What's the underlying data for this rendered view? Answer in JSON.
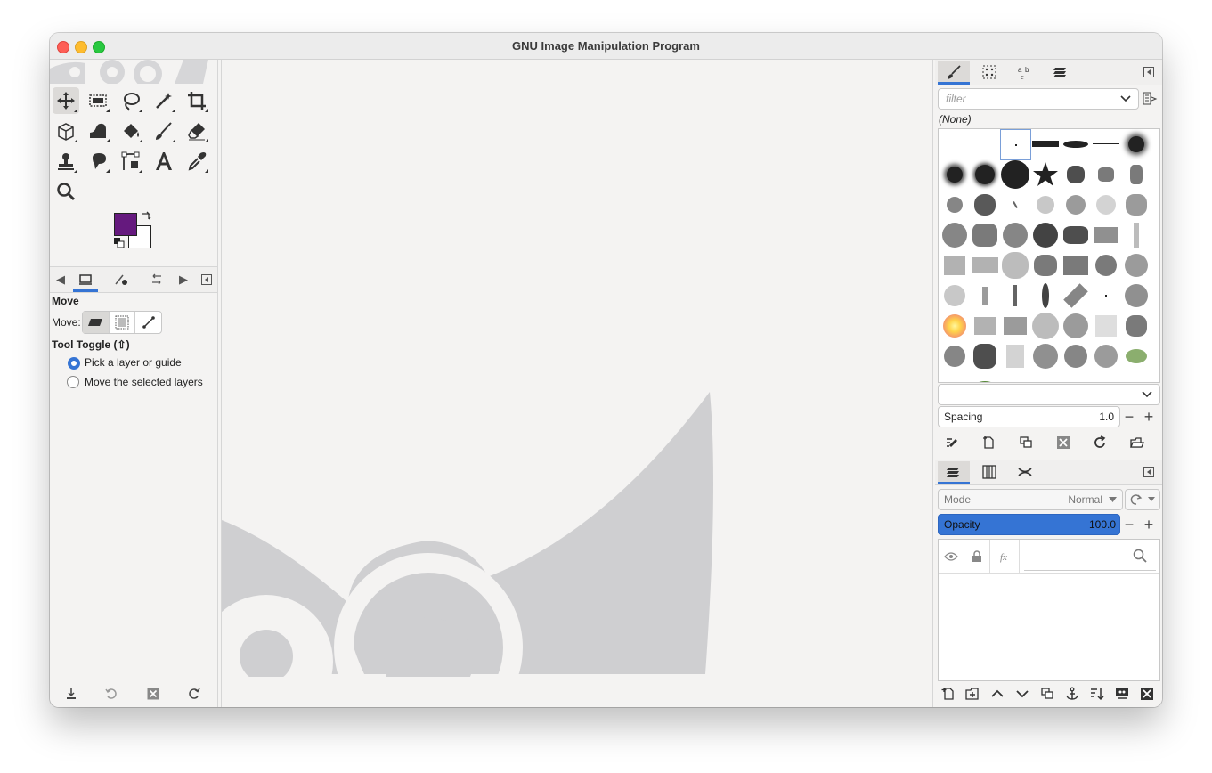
{
  "window": {
    "title": "GNU Image Manipulation Program"
  },
  "toolbox": {
    "tools": [
      {
        "name": "move-tool",
        "icon": "move-icon",
        "active": true
      },
      {
        "name": "rect-select-tool",
        "icon": "rect-select-icon"
      },
      {
        "name": "free-select-tool",
        "icon": "lasso-icon"
      },
      {
        "name": "fuzzy-select-tool",
        "icon": "magic-wand-icon"
      },
      {
        "name": "crop-tool",
        "icon": "crop-icon"
      },
      {
        "name": "unified-transform-tool",
        "icon": "transform-cube-icon"
      },
      {
        "name": "warp-transform-tool",
        "icon": "warp-icon"
      },
      {
        "name": "bucket-fill-tool",
        "icon": "bucket-fill-icon"
      },
      {
        "name": "paintbrush-tool",
        "icon": "paintbrush-icon"
      },
      {
        "name": "eraser-tool",
        "icon": "eraser-icon"
      },
      {
        "name": "clone-tool",
        "icon": "clone-stamp-icon"
      },
      {
        "name": "smudge-tool",
        "icon": "smudge-icon"
      },
      {
        "name": "paths-tool",
        "icon": "paths-icon"
      },
      {
        "name": "text-tool",
        "icon": "text-icon"
      },
      {
        "name": "color-picker-tool",
        "icon": "eyedropper-icon"
      },
      {
        "name": "zoom-tool",
        "icon": "zoom-icon"
      }
    ],
    "fg_color": "#65197e",
    "bg_color": "#ffffff",
    "options": {
      "title": "Move",
      "move_label": "Move:",
      "toggle_title": "Tool Toggle  (⇧)",
      "radio_1": "Pick a layer or guide",
      "radio_2": "Move the selected layers"
    }
  },
  "brushes": {
    "filter_placeholder": "filter",
    "selected_name": "(None)",
    "spacing_label": "Spacing",
    "spacing_value": "1.0"
  },
  "layers": {
    "mode_label": "Mode",
    "mode_value": "Normal",
    "opacity_label": "Opacity",
    "opacity_value": "100.0"
  },
  "colors": {
    "accent": "#3574d4",
    "wilber": "#cfcfd1"
  }
}
